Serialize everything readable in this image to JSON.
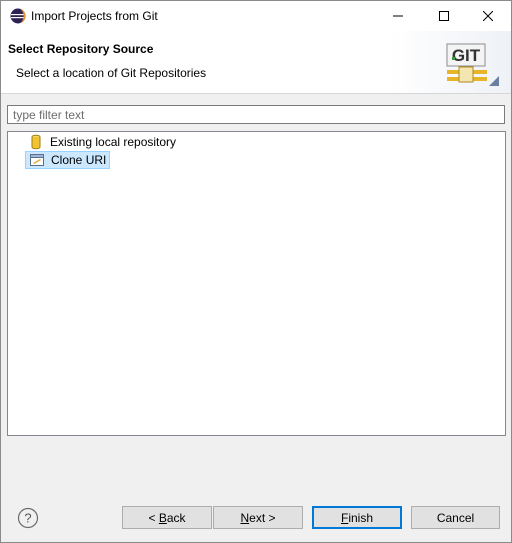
{
  "window": {
    "title": "Import Projects from Git",
    "icon": "eclipse-icon",
    "controls": [
      "minimize-icon",
      "maximize-icon",
      "close-icon"
    ]
  },
  "banner": {
    "title": "Select Repository Source",
    "description": "Select a location of Git Repositories",
    "logo_text": "GIT"
  },
  "filter": {
    "placeholder": "type filter text",
    "value": ""
  },
  "tree": {
    "items": [
      {
        "label": "Existing local repository",
        "icon": "repository-icon",
        "selected": false
      },
      {
        "label": "Clone URI",
        "icon": "clone-uri-icon",
        "selected": true
      }
    ]
  },
  "buttons": {
    "help": "?",
    "back_pre": "< ",
    "back_mnemonic": "B",
    "back_post": "ack",
    "next_mnemonic": "N",
    "next_post": "ext >",
    "finish_mnemonic": "F",
    "finish_post": "inish",
    "cancel": "Cancel"
  },
  "colors": {
    "selection_bg": "#cce8ff",
    "selection_border": "#99d1ff",
    "default_button_border": "#0078d7",
    "dialog_bg": "#f0f0f0"
  }
}
